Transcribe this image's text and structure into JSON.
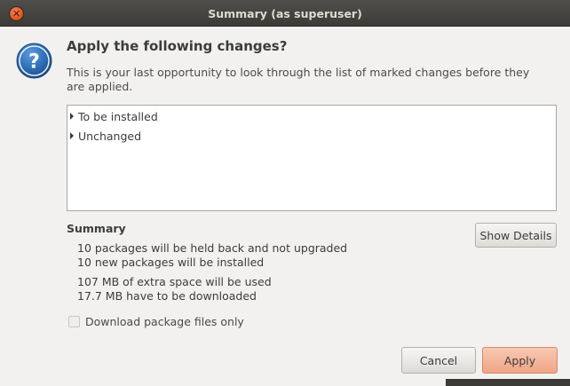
{
  "window": {
    "title": "Summary (as superuser)",
    "close_icon": "close-icon"
  },
  "dialog": {
    "icon": "question-mark-icon",
    "icon_color": "#2d6fb7",
    "heading": "Apply the following changes?",
    "description": "This is your last opportunity to look through the list of marked changes before they are applied."
  },
  "changes_tree": {
    "items": [
      {
        "label": "To be installed",
        "expanded": false
      },
      {
        "label": "Unchanged",
        "expanded": false
      }
    ]
  },
  "summary": {
    "title": "Summary",
    "lines": [
      "10 packages will be held back and not upgraded",
      "10 new packages will be installed",
      "107 MB of extra space will be used",
      "17.7 MB have to be downloaded"
    ],
    "show_details_label": "Show Details"
  },
  "options": {
    "download_only_label": "Download package files only",
    "download_only_checked": false
  },
  "buttons": {
    "cancel_label": "Cancel",
    "apply_label": "Apply",
    "apply_color": "#f0aa8a"
  }
}
